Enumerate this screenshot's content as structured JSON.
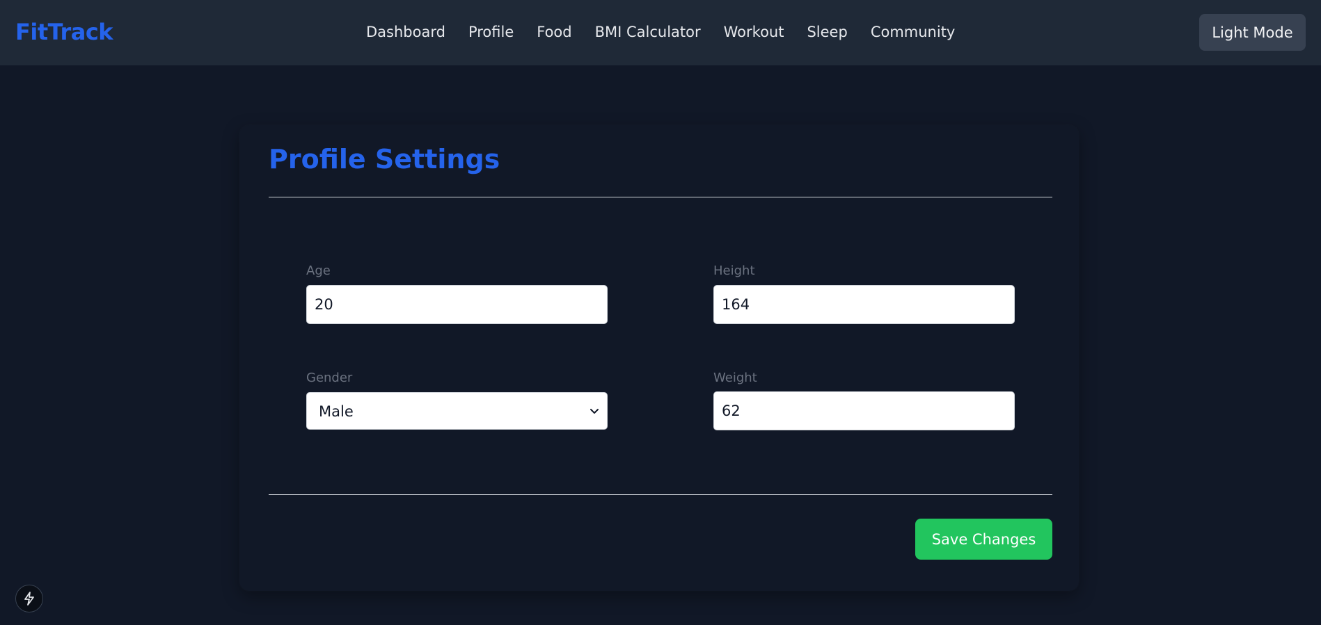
{
  "brand": {
    "name": "FitTrack",
    "color": "#2563eb"
  },
  "nav": {
    "items": [
      {
        "label": "Dashboard"
      },
      {
        "label": "Profile"
      },
      {
        "label": "Food"
      },
      {
        "label": "BMI Calculator"
      },
      {
        "label": "Workout"
      },
      {
        "label": "Sleep"
      },
      {
        "label": "Community"
      }
    ],
    "mode_button_label": "Light Mode"
  },
  "profile": {
    "title": "Profile Settings",
    "fields": {
      "age": {
        "label": "Age",
        "value": "20"
      },
      "height": {
        "label": "Height",
        "value": "164"
      },
      "gender": {
        "label": "Gender",
        "value": "Male"
      },
      "weight": {
        "label": "Weight",
        "value": "62"
      }
    },
    "save_label": "Save Changes"
  },
  "colors": {
    "background": "#111827",
    "navbar": "#1f2937",
    "accent": "#2563eb",
    "save": "#22c55e"
  },
  "icons": {
    "select_chevron": "chevron-down-icon",
    "dev_tools": "lightning-bolt-icon"
  }
}
